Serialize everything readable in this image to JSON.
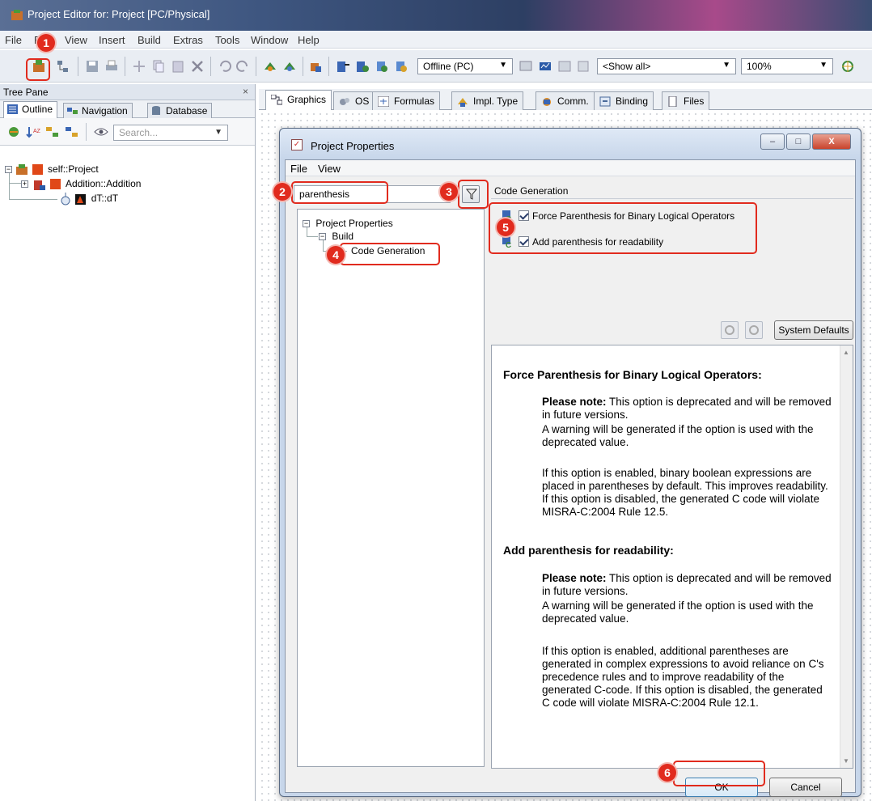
{
  "window": {
    "title": "Project Editor for: Project [PC/Physical]"
  },
  "menubar": [
    "File",
    "Edit",
    "View",
    "Insert",
    "Build",
    "Extras",
    "Tools",
    "Window",
    "Help"
  ],
  "toolbar": {
    "mode": "Offline (PC)",
    "filter": "<Show all>",
    "zoom": "100%"
  },
  "tree_pane": {
    "title": "Tree Pane",
    "close": "×",
    "tabs": [
      "Outline",
      "Navigation",
      "Database"
    ],
    "search_placeholder": "Search...",
    "nodes": [
      "self::Project",
      "Addition::Addition",
      "dT::dT"
    ]
  },
  "editor_tabs": [
    "Graphics",
    "OS",
    "Formulas",
    "Impl. Type",
    "Comm.",
    "Binding",
    "Files"
  ],
  "dialog": {
    "title": "Project Properties",
    "window_buttons": [
      "–",
      "□",
      "X"
    ],
    "menu": [
      "File",
      "View"
    ],
    "filter_value": "parenthesis",
    "tree": [
      "Project Properties",
      "Build",
      "Code Generation"
    ],
    "group_title": "Code Generation",
    "options": [
      "Force Parenthesis for Binary Logical Operators",
      "Add parenthesis for readability"
    ],
    "system_defaults": "System Defaults",
    "help": {
      "heading1": "Force Parenthesis for Binary Logical Operators:",
      "note_label": "Please note:",
      "note1": " This option is deprecated and will be removed in future versions.",
      "warn1": "A warning will be generated if the option is used with the deprecated value.",
      "body1": "If this option is enabled, binary boolean expressions are placed in parentheses by default. This improves readability. If this option is disabled, the generated C code will violate MISRA-C:2004 Rule 12.5.",
      "heading2": "Add parenthesis for readability:",
      "note2": " This option is deprecated and will be removed in future versions.",
      "warn2": "A warning will be generated if the option is used with the deprecated value.",
      "body2": "If this option is enabled, additional parentheses are generated in complex expressions to avoid reliance on C's precedence rules and to improve readability of the generated C-code. If this option is disabled, the generated C code will violate MISRA-C:2004 Rule 12.1."
    },
    "ok": "OK",
    "cancel": "Cancel"
  },
  "markers": [
    "1",
    "2",
    "3",
    "4",
    "5",
    "6"
  ]
}
